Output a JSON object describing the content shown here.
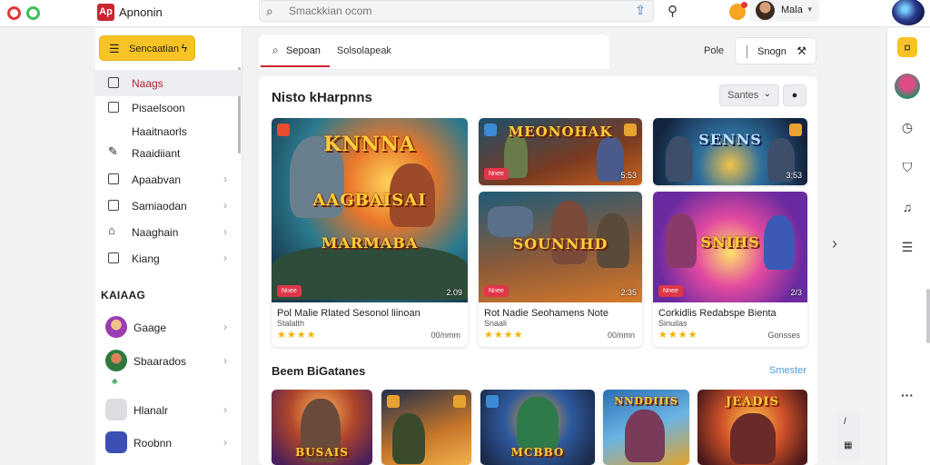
{
  "app": {
    "name": "Apnonin",
    "logo_text": "Ap"
  },
  "search": {
    "placeholder": "Smackkian ocom"
  },
  "profile": {
    "name": "Mala"
  },
  "sidebar": {
    "primary_button": "Sencaatian",
    "items": [
      {
        "label": "Naags",
        "icon": "square-icon",
        "active": true,
        "chevron": false
      },
      {
        "label": "Pisaelsoon",
        "icon": "square-icon",
        "active": false,
        "chevron": false
      },
      {
        "label": "Haaitnaorls",
        "icon": "none",
        "active": false,
        "chevron": false
      },
      {
        "label": "Raaidiiant",
        "icon": "edit-icon",
        "active": false,
        "chevron": false
      },
      {
        "label": "Apaabvan",
        "icon": "square-icon",
        "active": false,
        "chevron": true
      },
      {
        "label": "Samiaodan",
        "icon": "square-icon",
        "active": false,
        "chevron": true
      },
      {
        "label": "Naaghain",
        "icon": "tag-icon",
        "active": false,
        "chevron": true
      },
      {
        "label": "Kiang",
        "icon": "square-icon",
        "active": false,
        "chevron": true
      }
    ],
    "section_title": "KAIAAG",
    "friends": [
      {
        "name": "Gaage",
        "avatar_color": "#9a3db0"
      },
      {
        "name": "Sbaarados",
        "avatar_color": "#3d8a4a",
        "sub": "♣"
      },
      {
        "name": "Hlanalr",
        "avatar_color": "#d9d9dc"
      },
      {
        "name": "Roobnn",
        "avatar_color": "#3b4fb5"
      }
    ]
  },
  "tabs": [
    {
      "label": "Sepoan",
      "icon": "search-icon",
      "active": true
    },
    {
      "label": "Solsolapeak",
      "active": false
    }
  ],
  "header_role": "Pole",
  "segment": {
    "label": "Snogn",
    "icon": "tool-icon"
  },
  "featured": {
    "title": "Nisto kHarpnns",
    "sort_label": "Santes",
    "cards": [
      {
        "art_title": "KNNNA\nAAGBAISAI\nMARMABA",
        "badge": "Nnee",
        "plays": "2.09",
        "caption": "Pol Malie Rlated Sesonol liinoan",
        "subcaption": "Stalalth",
        "stars": "★★★★",
        "meta": "00/nmm"
      },
      {
        "art_title": "MEONOHAK",
        "badge": "Nnee",
        "plays": "5:53"
      },
      {
        "art_title": "SENNS",
        "plays": "3:53"
      },
      {
        "art_title": "SOUNNHD",
        "badge": "Nnee",
        "plays": "2:35",
        "caption": "Rot Nadie Seohamens Note",
        "subcaption": "Snaali",
        "stars": "★★★★",
        "meta": "00/nmn"
      },
      {
        "art_title": "SNIHS",
        "badge": "Nnee",
        "plays": "2/3",
        "caption": "Corkidlis Redabspe Bienta",
        "subcaption": "Sinuilas",
        "stars": "★★★★",
        "meta": "Gonsses"
      }
    ]
  },
  "section2": {
    "title": "Beem BiGatanes",
    "see_more": "Smester",
    "cards": [
      {
        "art_title": "BUSAIS"
      },
      {
        "art_title": ""
      },
      {
        "art_title": "MCBBO"
      },
      {
        "art_title": "NNDDIIIS"
      },
      {
        "art_title": "JEADIS"
      }
    ]
  },
  "rail": {
    "more_label": "···"
  },
  "colors": {
    "accent": "#c8252f",
    "primary": "#f7c325",
    "star": "#f4b400",
    "link": "#4a9ad8"
  }
}
